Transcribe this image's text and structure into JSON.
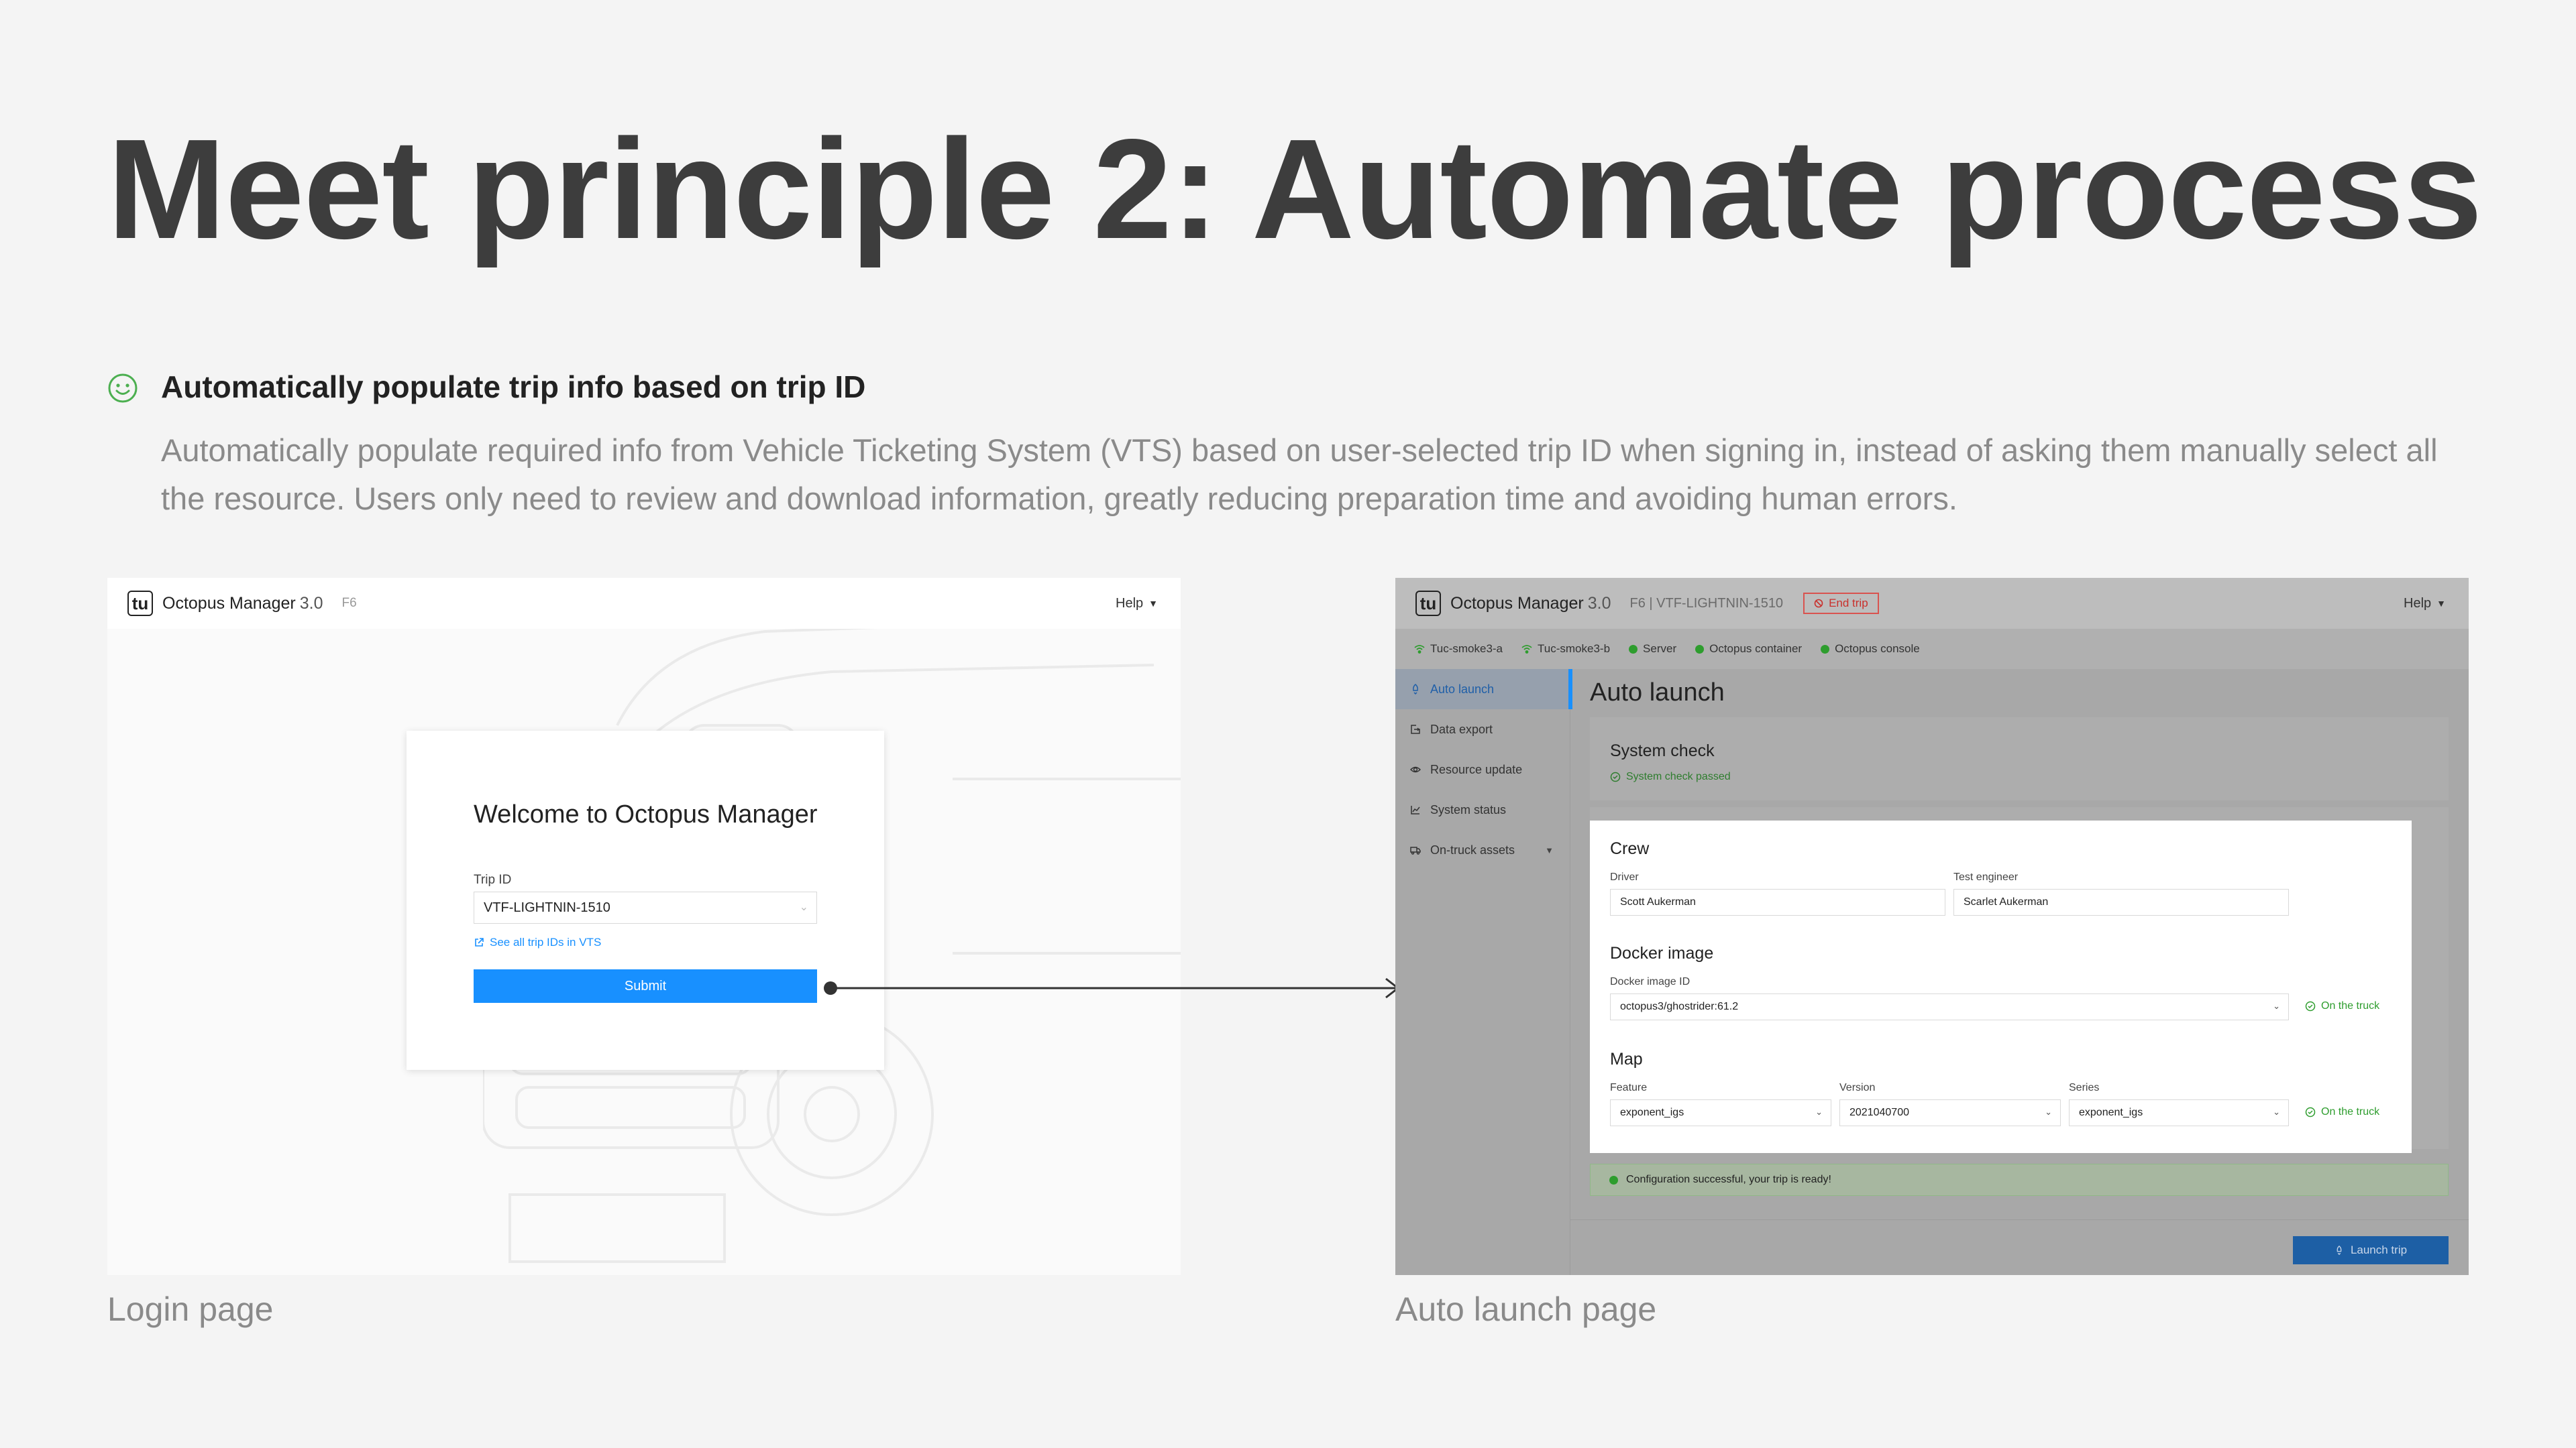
{
  "slide": {
    "title": "Meet principle 2: Automate process",
    "principle_heading": "Automatically populate trip info based on trip ID",
    "principle_description": "Automatically populate required info from Vehicle Ticketing System (VTS) based on user-selected trip ID when signing in, instead of asking them manually select all the resource. Users only need to review and download information, greatly reducing preparation time and avoiding human errors.",
    "icon": "smile-icon",
    "accent_color": "#4caf50"
  },
  "login": {
    "caption": "Login page",
    "logo_text": "tu",
    "app_name": "Octopus Manager",
    "app_version": "3.0",
    "fleet": "F6",
    "help_label": "Help",
    "welcome": "Welcome to Octopus Manager",
    "trip_id_label": "Trip ID",
    "trip_id_value": "VTF-LIGHTNIN-1510",
    "vts_link": "See all trip IDs in VTS",
    "submit_label": "Submit",
    "primary_color": "#1890ff"
  },
  "auto_launch": {
    "caption": "Auto launch page",
    "logo_text": "tu",
    "app_name": "Octopus Manager",
    "app_version": "3.0",
    "trip_info": "F6 | VTF-LIGHTNIN-1510",
    "end_trip_label": "End trip",
    "help_label": "Help",
    "status_items": [
      {
        "label": "Tuc-smoke3-a",
        "icon": "wifi-icon"
      },
      {
        "label": "Tuc-smoke3-b",
        "icon": "wifi-icon"
      },
      {
        "label": "Server",
        "icon": "status-dot-icon"
      },
      {
        "label": "Octopus container",
        "icon": "status-dot-icon"
      },
      {
        "label": "Octopus console",
        "icon": "status-dot-icon"
      }
    ],
    "nav": [
      {
        "label": "Auto launch",
        "icon": "rocket-icon"
      },
      {
        "label": "Data export",
        "icon": "export-icon"
      },
      {
        "label": "Resource update",
        "icon": "eye-icon"
      },
      {
        "label": "System status",
        "icon": "line-chart-icon"
      },
      {
        "label": "On-truck assets",
        "icon": "truck-icon"
      }
    ],
    "page_title": "Auto launch",
    "system_check": {
      "title": "System check",
      "status": "System check passed"
    },
    "crew": {
      "title": "Crew",
      "driver_label": "Driver",
      "driver_value": "Scott Aukerman",
      "engineer_label": "Test engineer",
      "engineer_value": "Scarlet Aukerman"
    },
    "docker": {
      "title": "Docker image",
      "id_label": "Docker image ID",
      "id_value": "octopus3/ghostrider:61.2",
      "status": "On the truck"
    },
    "map": {
      "title": "Map",
      "feature_label": "Feature",
      "feature_value": "exponent_igs",
      "version_label": "Version",
      "version_value": "2021040700",
      "series_label": "Series",
      "series_value": "exponent_igs",
      "status": "On the truck"
    },
    "success_message": "Configuration successful, your trip is ready!",
    "launch_label": "Launch trip",
    "success_color": "#2e9d2e",
    "danger_color": "#d9534f"
  }
}
